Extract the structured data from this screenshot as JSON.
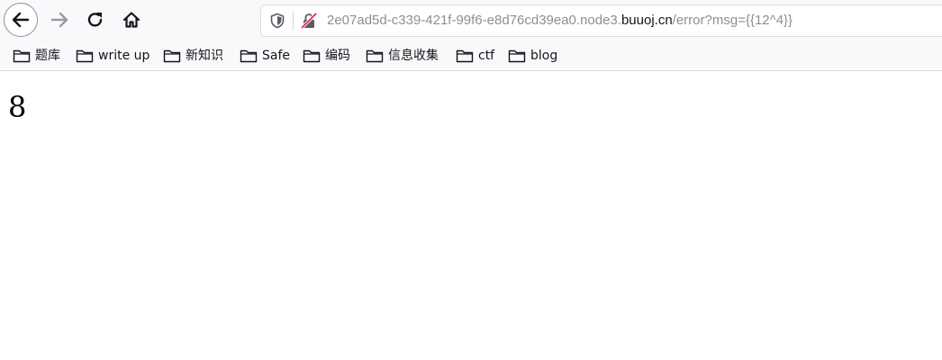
{
  "toolbar": {
    "back_icon": "arrow-left-icon",
    "forward_icon": "arrow-right-icon",
    "reload_icon": "reload-icon",
    "home_icon": "home-icon"
  },
  "urlbar": {
    "url_prefix": "2e07ad5d-c339-421f-99f6-e8d76cd39ea0.node3.",
    "url_domain": "buuoj.cn",
    "url_suffix": "/error?msg={{12^4}}",
    "tracking_icon": "shield-icon",
    "security_icon": "insecure-lock-icon"
  },
  "bookmarks": [
    {
      "label": "题库"
    },
    {
      "label": "write up"
    },
    {
      "label": "新知识"
    },
    {
      "label": "Safe"
    },
    {
      "label": "编码"
    },
    {
      "label": "信息收集"
    },
    {
      "label": "ctf"
    },
    {
      "label": "blog"
    }
  ],
  "page": {
    "result": "8"
  },
  "colors": {
    "toolbar_bg": "#f9f9fb",
    "url_muted": "#8e8e94",
    "url_domain": "#15141a"
  }
}
